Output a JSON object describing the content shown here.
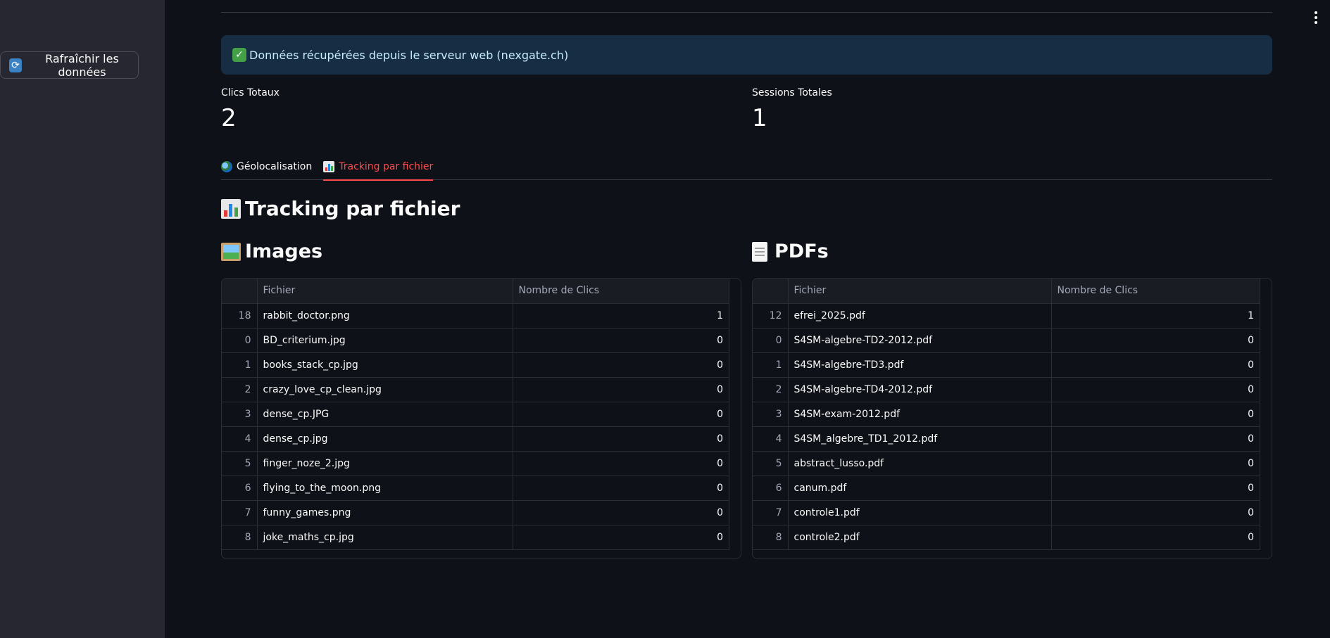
{
  "sidebar": {
    "refresh_button": "Rafraîchir les données"
  },
  "alert": {
    "message": "Données récupérées depuis le serveur web (nexgate.ch)"
  },
  "metrics": [
    {
      "label": "Clics Totaux",
      "value": "2"
    },
    {
      "label": "Sessions Totales",
      "value": "1"
    }
  ],
  "tabs": [
    {
      "label": "Géolocalisation",
      "icon": "globe-icon",
      "active": false
    },
    {
      "label": "Tracking par fichier",
      "icon": "bar-chart-icon",
      "active": true
    }
  ],
  "section_title": "Tracking par fichier",
  "images": {
    "title": "Images",
    "columns": [
      "",
      "Fichier",
      "Nombre de Clics"
    ],
    "rows": [
      {
        "index": "18",
        "file": "rabbit_doctor.png",
        "clicks": "1"
      },
      {
        "index": "0",
        "file": "BD_criterium.jpg",
        "clicks": "0"
      },
      {
        "index": "1",
        "file": "books_stack_cp.jpg",
        "clicks": "0"
      },
      {
        "index": "2",
        "file": "crazy_love_cp_clean.jpg",
        "clicks": "0"
      },
      {
        "index": "3",
        "file": "dense_cp.JPG",
        "clicks": "0"
      },
      {
        "index": "4",
        "file": "dense_cp.jpg",
        "clicks": "0"
      },
      {
        "index": "5",
        "file": "finger_noze_2.jpg",
        "clicks": "0"
      },
      {
        "index": "6",
        "file": "flying_to_the_moon.png",
        "clicks": "0"
      },
      {
        "index": "7",
        "file": "funny_games.png",
        "clicks": "0"
      },
      {
        "index": "8",
        "file": "joke_maths_cp.jpg",
        "clicks": "0"
      }
    ]
  },
  "pdfs": {
    "title": "PDFs",
    "columns": [
      "",
      "Fichier",
      "Nombre de Clics"
    ],
    "rows": [
      {
        "index": "12",
        "file": "efrei_2025.pdf",
        "clicks": "1"
      },
      {
        "index": "0",
        "file": "S4SM-algebre-TD2-2012.pdf",
        "clicks": "0"
      },
      {
        "index": "1",
        "file": "S4SM-algebre-TD3.pdf",
        "clicks": "0"
      },
      {
        "index": "2",
        "file": "S4SM-algebre-TD4-2012.pdf",
        "clicks": "0"
      },
      {
        "index": "3",
        "file": "S4SM-exam-2012.pdf",
        "clicks": "0"
      },
      {
        "index": "4",
        "file": "S4SM_algebre_TD1_2012.pdf",
        "clicks": "0"
      },
      {
        "index": "5",
        "file": "abstract_lusso.pdf",
        "clicks": "0"
      },
      {
        "index": "6",
        "file": "canum.pdf",
        "clicks": "0"
      },
      {
        "index": "7",
        "file": "controle1.pdf",
        "clicks": "0"
      },
      {
        "index": "8",
        "file": "controle2.pdf",
        "clicks": "0"
      }
    ]
  },
  "colors": {
    "accent": "#ff4b4b",
    "background": "#0e1117",
    "sidebar": "#262730",
    "alert_bg": "#172d43"
  }
}
